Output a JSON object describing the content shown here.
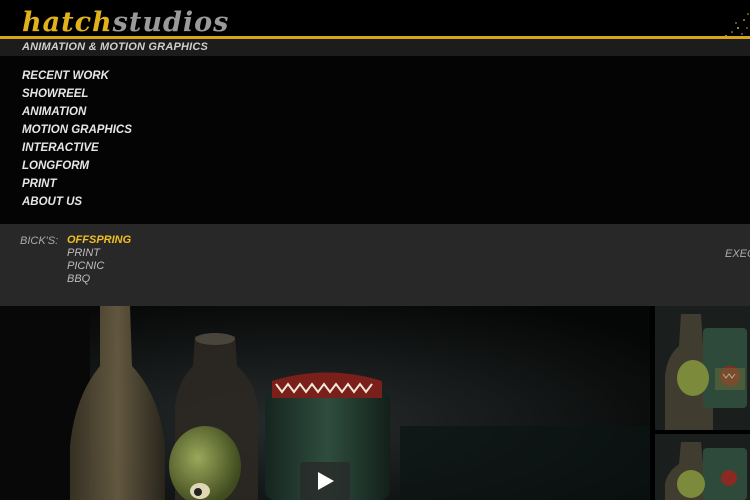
{
  "logo": {
    "part1": "hatch",
    "part2": "studios"
  },
  "tagline": "ANIMATION & MOTION GRAPHICS",
  "nav": [
    "RECENT WORK",
    "SHOWREEL",
    "ANIMATION",
    "MOTION GRAPHICS",
    "INTERACTIVE",
    "LONGFORM",
    "PRINT",
    "ABOUT US"
  ],
  "project": {
    "client": "BICK'S:",
    "items": [
      "OFFSPRING",
      "PRINT",
      "PICNIC",
      "BBQ"
    ],
    "active_index": 0,
    "right_label": "EXEC"
  },
  "video": {
    "play_icon": "play-icon"
  },
  "colors": {
    "accent": "#e2b21a",
    "active": "#f0c020",
    "bg": "#000000",
    "subbar": "#282828"
  }
}
